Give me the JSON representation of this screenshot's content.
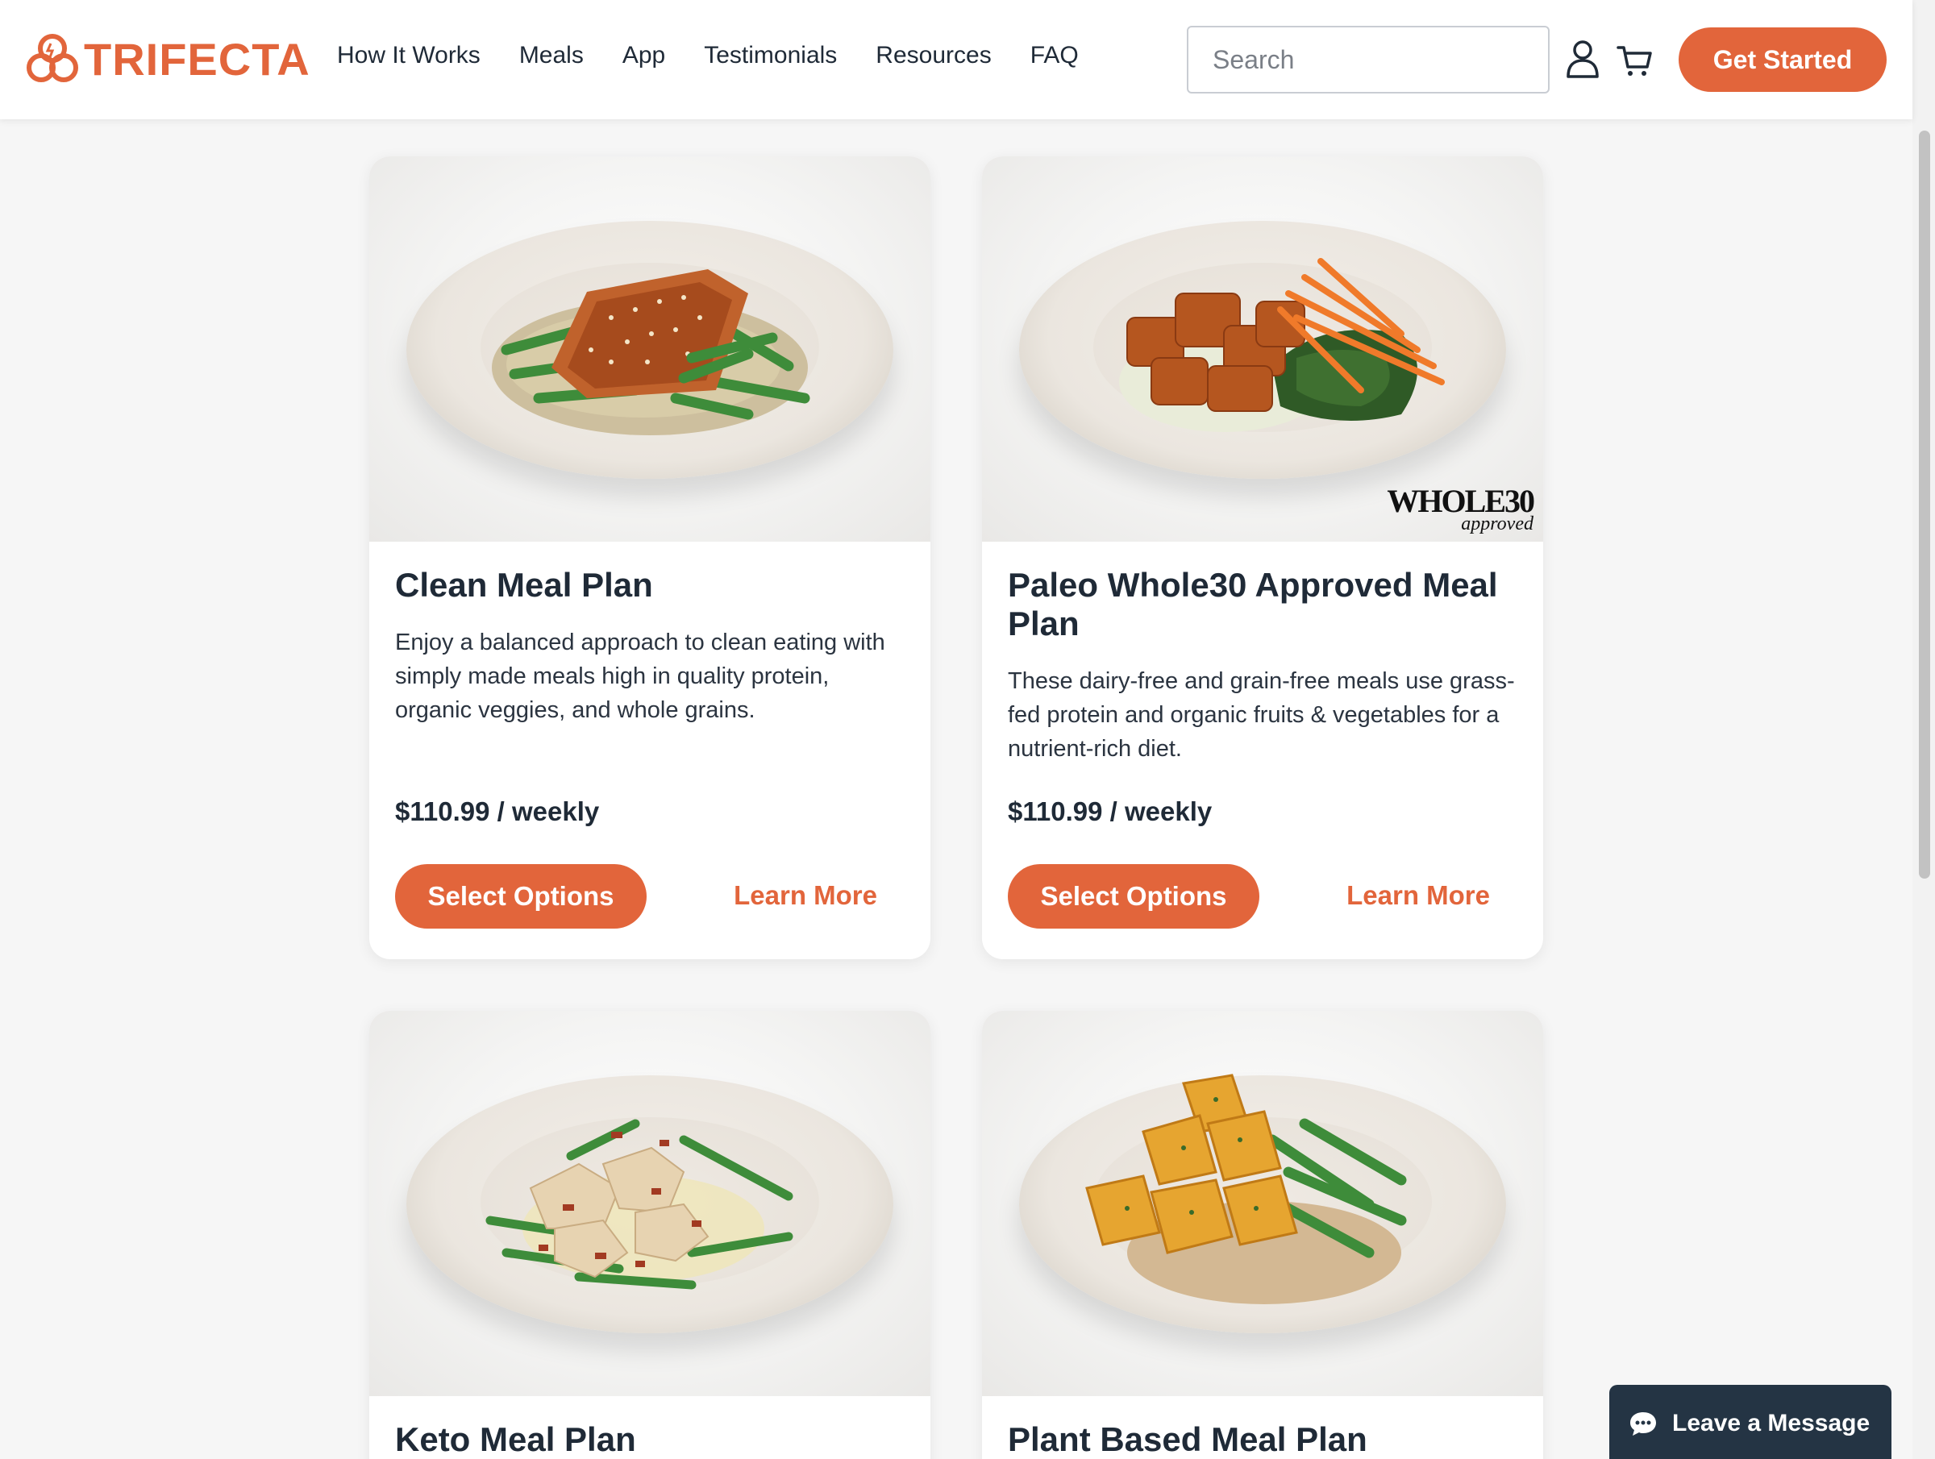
{
  "brand": {
    "name": "TRIFECTA",
    "accent": "#e2653b",
    "dark": "#1f2a37"
  },
  "nav": {
    "items": [
      "How It Works",
      "Meals",
      "App",
      "Testimonials",
      "Resources",
      "FAQ"
    ]
  },
  "search": {
    "placeholder": "Search",
    "value": ""
  },
  "header": {
    "cta_label": "Get Started",
    "account_icon": "user-icon",
    "cart_icon": "cart-icon"
  },
  "cards": [
    {
      "title": "Clean Meal Plan",
      "description": "Enjoy a balanced approach to clean eating with simply made meals high in quality protein, organic veggies, and whole grains.",
      "price": "$110.99 / weekly",
      "select_label": "Select Options",
      "learn_label": "Learn More"
    },
    {
      "title": "Paleo Whole30 Approved Meal Plan",
      "description": "These dairy-free and grain-free meals use grass-fed protein and organic fruits & vegetables for a nutrient-rich diet.",
      "price": "$110.99 / weekly",
      "select_label": "Select Options",
      "learn_label": "Learn More",
      "badge_main": "WHOLE30",
      "badge_sub": "approved"
    },
    {
      "title": "Keto Meal Plan"
    },
    {
      "title": "Plant Based Meal Plan"
    }
  ],
  "chat": {
    "label": "Leave a Message",
    "icon": "chat-bubble-icon"
  }
}
